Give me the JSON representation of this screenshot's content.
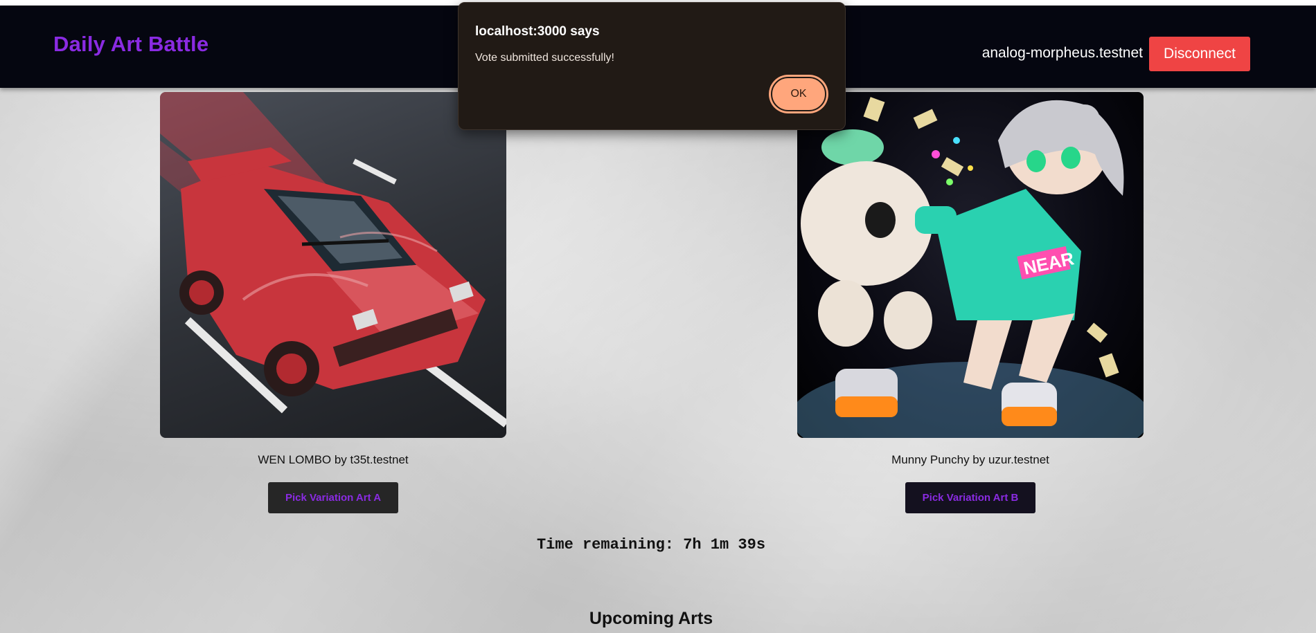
{
  "header": {
    "brand": "Daily Art Battle",
    "account_id": "analog-morpheus.testnet",
    "disconnect_label": "Disconnect"
  },
  "battle": {
    "art_a": {
      "caption": "WEN LOMBO by t35t.testnet",
      "button_label": "Pick Variation Art A"
    },
    "art_b": {
      "caption": "Munny Punchy by uzur.testnet",
      "button_label": "Pick Variation Art B",
      "hoodie_text": "NEAR"
    },
    "timer": "Time remaining: 7h 1m 39s"
  },
  "upcoming": {
    "title": "Upcoming Arts"
  },
  "alert": {
    "title": "localhost:3000 says",
    "message": "Vote submitted successfully!",
    "ok_label": "OK"
  },
  "colors": {
    "brand": "#8a2be2",
    "navbar": "#050610",
    "disconnect": "#ef4444",
    "dialog_bg": "#211a15",
    "ok_button": "#ffa67c"
  }
}
